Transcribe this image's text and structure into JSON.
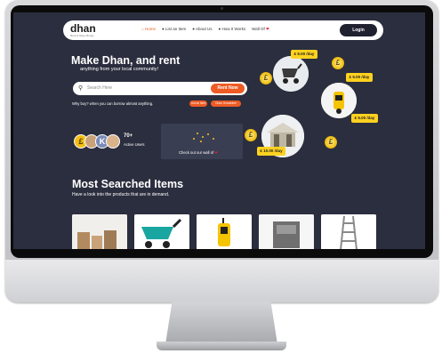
{
  "nav": {
    "logo": "dhan",
    "logo_tagline": "Rent & Save Money",
    "items": [
      "Home",
      "List an Item",
      "About Us",
      "How It Works",
      "Wall Of"
    ],
    "active_index": 0,
    "login_label": "Login"
  },
  "hero": {
    "title": "Make Dhan, and rent",
    "subtitle": "anything from your local community!",
    "search_placeholder": "Search Here",
    "search_button": "Rent Now",
    "why_text": "Why buy? when you can borrow almost anything.",
    "pill_list": "List an Item",
    "pill_guarantee": "Dhan Guarantee",
    "users_count": "70+",
    "users_label": "Active Users",
    "map_caption": "Check out our wall of",
    "price_tags": [
      "£ 5.00 /day",
      "£ 5.00 /day",
      "£ 10.00 /day",
      "£ 5.00 /day"
    ]
  },
  "section": {
    "title": "Most Searched Items",
    "subtitle": "Have a look into the products that are in demand."
  },
  "colors": {
    "background": "#2b2e3e",
    "accent": "#ee5b24",
    "tag_yellow": "#ffd21f",
    "coin_gold": "#f2c016"
  }
}
